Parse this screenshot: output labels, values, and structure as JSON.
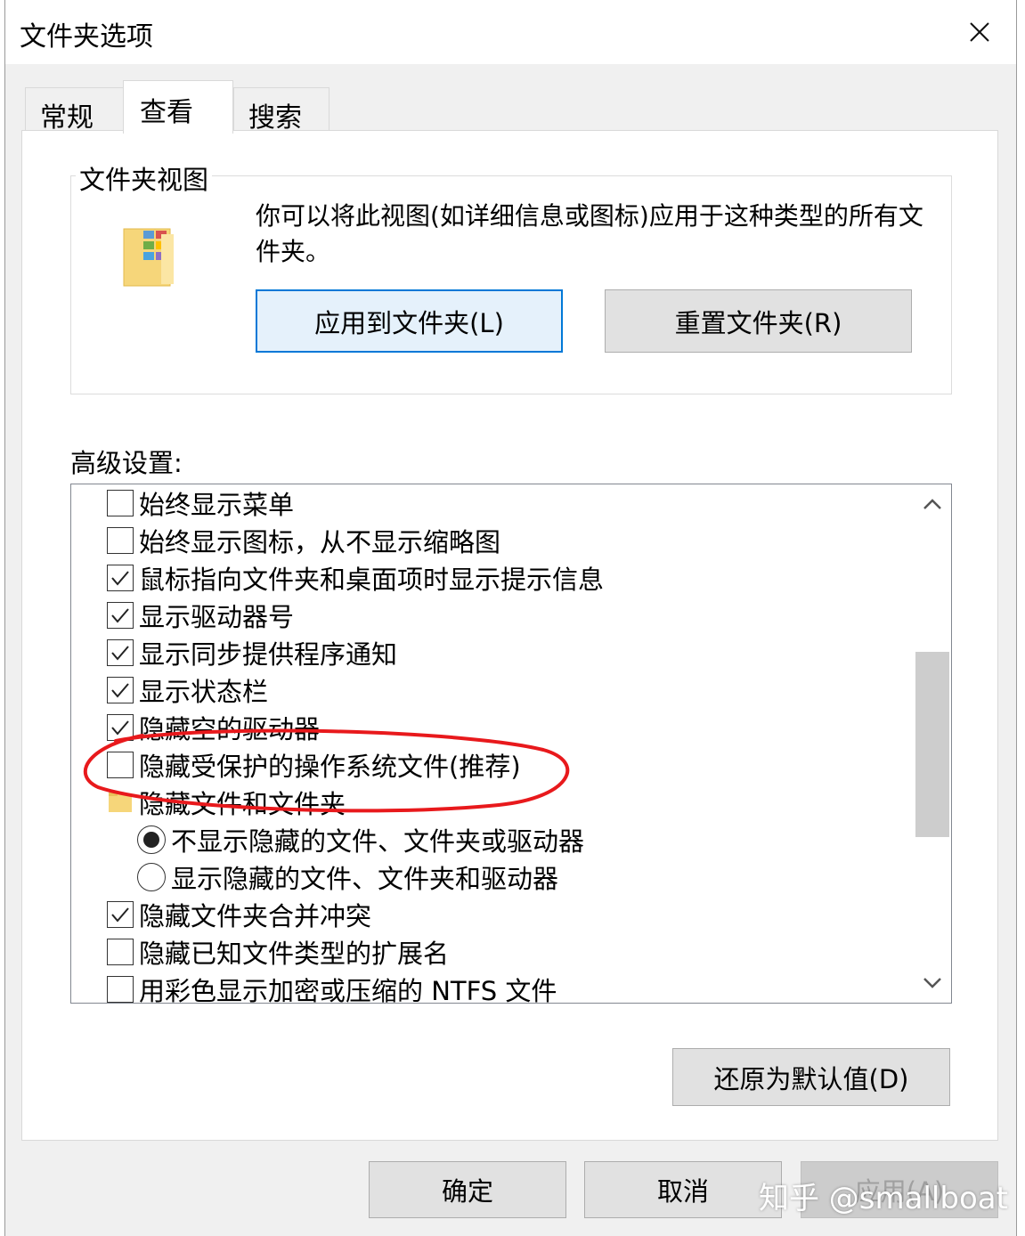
{
  "window": {
    "title": "文件夹选项",
    "close_icon": "close-icon"
  },
  "tabs": [
    {
      "label": "常规",
      "active": false
    },
    {
      "label": "查看",
      "active": true
    },
    {
      "label": "搜索",
      "active": false
    }
  ],
  "folder_views": {
    "group_label": "文件夹视图",
    "description": "你可以将此视图(如详细信息或图标)应用于这种类型的所有文件夹。",
    "apply_button": "应用到文件夹(L)",
    "reset_button": "重置文件夹(R)"
  },
  "advanced": {
    "label": "高级设置:",
    "items": [
      {
        "type": "checkbox",
        "checked": false,
        "label": "始终显示菜单"
      },
      {
        "type": "checkbox",
        "checked": false,
        "label": "始终显示图标，从不显示缩略图"
      },
      {
        "type": "checkbox",
        "checked": true,
        "label": "鼠标指向文件夹和桌面项时显示提示信息"
      },
      {
        "type": "checkbox",
        "checked": true,
        "label": "显示驱动器号"
      },
      {
        "type": "checkbox",
        "checked": true,
        "label": "显示同步提供程序通知"
      },
      {
        "type": "checkbox",
        "checked": true,
        "label": "显示状态栏"
      },
      {
        "type": "checkbox",
        "checked": true,
        "label": "隐藏空的驱动器"
      },
      {
        "type": "checkbox",
        "checked": false,
        "label": "隐藏受保护的操作系统文件(推荐)"
      },
      {
        "type": "folder",
        "label": "隐藏文件和文件夹"
      },
      {
        "type": "radio",
        "checked": true,
        "label": "不显示隐藏的文件、文件夹或驱动器"
      },
      {
        "type": "radio",
        "checked": false,
        "label": "显示隐藏的文件、文件夹和驱动器"
      },
      {
        "type": "checkbox",
        "checked": true,
        "label": "隐藏文件夹合并冲突"
      },
      {
        "type": "checkbox",
        "checked": false,
        "label": "隐藏已知文件类型的扩展名"
      },
      {
        "type": "checkbox",
        "checked": false,
        "label": "用彩色显示加密或压缩的 NTFS 文件"
      }
    ],
    "restore_defaults_button": "还原为默认值(D)"
  },
  "footer": {
    "ok_button": "确定",
    "cancel_button": "取消",
    "apply_button": "应用(A)",
    "apply_enabled": false
  },
  "watermark": "知乎 @smallboat",
  "colors": {
    "accent": "#0078d7",
    "annotation": "#e8191c",
    "dialog_bg": "#f0f0f0"
  }
}
